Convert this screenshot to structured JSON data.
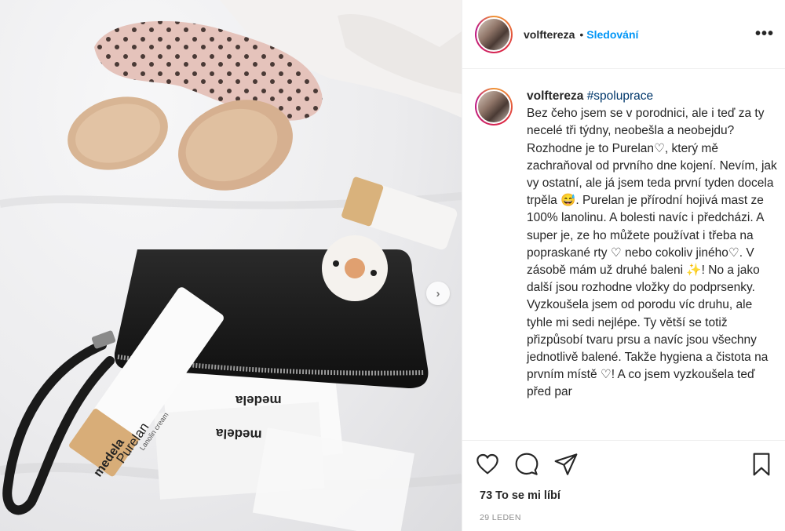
{
  "post": {
    "image_alt": "Baby in dotted romper, black clutch with Medela Purelan lanolin cream and breast pads",
    "product_label_1": "medela",
    "product_label_2": "Purelan",
    "product_label_3": "Lanolin cream",
    "pad_label": "medela",
    "pad_label_2": "medela"
  },
  "header": {
    "username": "volftereza",
    "dot": "•",
    "follow_label": "Sledování",
    "more_label": "•••"
  },
  "caption": {
    "username": "volftereza",
    "hashtag": "#spoluprace",
    "text": "Bez čeho jsem se v porodnici, ale i teď za ty necelé tři týdny, neobešla a neobejdu? Rozhodne je to Purelan♡, který mě zachraňoval od prvního dne kojení. Nevím, jak vy ostatní, ale já jsem teda první tyden docela trpěla 😅. Purelan je přírodní hojivá mast ze 100% lanolinu. A bolesti navíc i předcházi. A super je, ze ho můžete používat i třeba na popraskané rty ♡ nebo cokoliv jiného♡. V zásobě mám už druhé baleni ✨! No a jako další jsou rozhodne vložky do podprsenky. Vyzkoušela jsem od porodu víc druhu, ale tyhle mi sedi nejlépe. Ty větší se totiž přizpůsobí tvaru prsu a navíc jsou všechny jednotlivě balené. Takže hygiena a čistota na prvním místě ♡! A co jsem vyzkoušela teď před par"
  },
  "footer": {
    "likes": "73 To se mi líbí",
    "date": "29 LEDEN"
  },
  "icons": {
    "next": "chevron-right-icon",
    "like": "heart-icon",
    "comment": "comment-icon",
    "share": "paper-plane-icon",
    "save": "bookmark-icon"
  }
}
